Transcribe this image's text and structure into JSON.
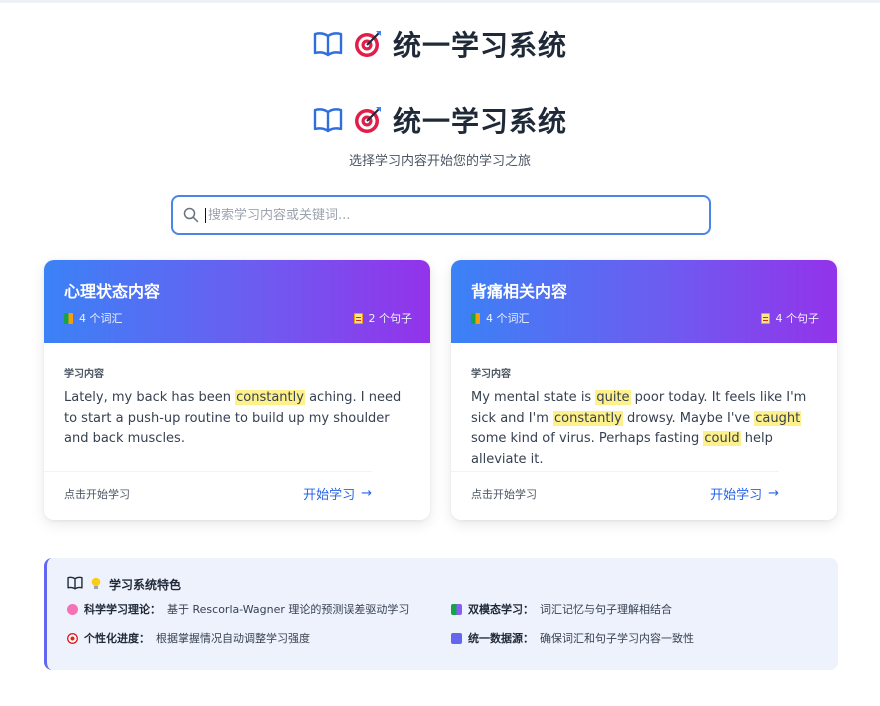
{
  "header": {
    "title": "统一学习系统",
    "subtitle": "选择学习内容开始您的学习之旅"
  },
  "search": {
    "placeholder": "搜索学习内容或关键词..."
  },
  "cards": [
    {
      "title": "心理状态内容",
      "word_count": "4 个词汇",
      "sentence_count": "2 个句子",
      "content_label": "学习内容",
      "content_segments": [
        {
          "text": "Lately, my back has been ",
          "hl": false
        },
        {
          "text": "constantly",
          "hl": true
        },
        {
          "text": " aching. I need to start a push-up routine to build up my shoulder and back muscles.",
          "hl": false
        }
      ],
      "footer_hint": "点击开始学习",
      "start_label": "开始学习"
    },
    {
      "title": "背痛相关内容",
      "word_count": "4 个词汇",
      "sentence_count": "4 个句子",
      "content_label": "学习内容",
      "content_segments": [
        {
          "text": "My mental state is ",
          "hl": false
        },
        {
          "text": "quite",
          "hl": true
        },
        {
          "text": " poor today. It feels like I'm sick and I'm ",
          "hl": false
        },
        {
          "text": "constantly",
          "hl": true
        },
        {
          "text": " drowsy. Maybe I've ",
          "hl": false
        },
        {
          "text": "caught",
          "hl": true
        },
        {
          "text": " some kind of virus. Perhaps fasting ",
          "hl": false
        },
        {
          "text": "could",
          "hl": true
        },
        {
          "text": " help alleviate it.",
          "hl": false
        }
      ],
      "footer_hint": "点击开始学习",
      "start_label": "开始学习"
    }
  ],
  "features": {
    "title": "学习系统特色",
    "items": [
      {
        "icon": "brain-icon",
        "label": "科学学习理论：",
        "desc": "基于 Rescorla-Wagner 理论的预测误差驱动学习"
      },
      {
        "icon": "books-icon",
        "label": "双模态学习：",
        "desc": "词汇记忆与句子理解相结合"
      },
      {
        "icon": "target-icon",
        "label": "个性化进度：",
        "desc": "根据掌握情况自动调整学习强度"
      },
      {
        "icon": "swap-icon",
        "label": "统一数据源：",
        "desc": "确保词汇和句子学习内容一致性"
      }
    ]
  },
  "colors": {
    "accent": "#4a86e8",
    "gradient_start": "#3b82f6",
    "gradient_end": "#9333ea",
    "highlight": "#fef08a",
    "link": "#2563eb"
  }
}
